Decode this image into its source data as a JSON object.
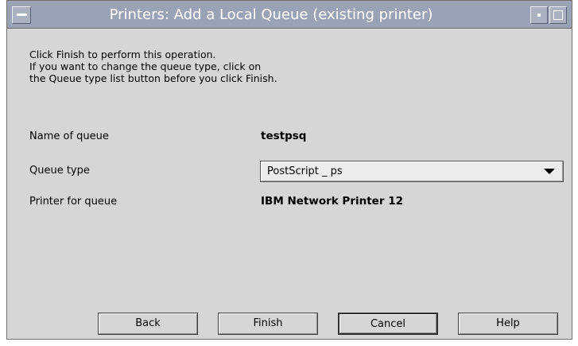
{
  "window": {
    "title": "Printers: Add a Local Queue (existing printer)"
  },
  "instructions": {
    "line1": "Click Finish to perform this operation.",
    "line2": "If you want to change the queue type, click on",
    "line3": "the Queue type list button before you click Finish."
  },
  "fields": {
    "queue_name_label": "Name of queue",
    "queue_name_value": "testpsq",
    "queue_type_label": "Queue type",
    "queue_type_value": "PostScript _ ps",
    "printer_label": "Printer for queue",
    "printer_value": "IBM Network Printer 12"
  },
  "buttons": {
    "back": "Back",
    "finish": "Finish",
    "cancel": "Cancel",
    "help": "Help"
  },
  "icons": {
    "window_menu": "window-menu-icon",
    "minimize": "minimize-icon",
    "maximize": "maximize-icon",
    "dropdown": "chevron-down-icon"
  },
  "colors": {
    "titlebar": "#9aa3b5",
    "window_bg": "#d6d6d6"
  }
}
